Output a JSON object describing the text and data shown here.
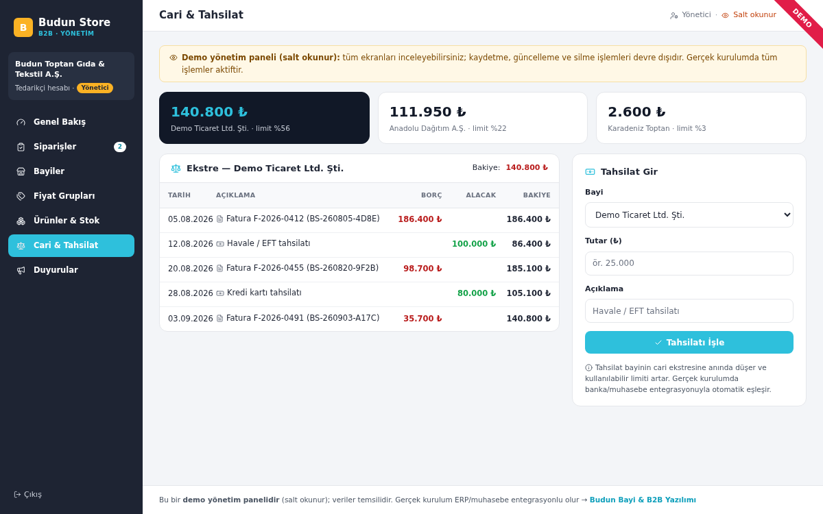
{
  "brand": {
    "logo_letter": "B",
    "name": "Budun Store",
    "subtitle": "B2B · YÖNETİM"
  },
  "account": {
    "company": "Budun Toptan Gıda & Tekstil A.Ş.",
    "type": "Tedarikçi hesabı ·",
    "role": "Yönetici"
  },
  "sidebar": {
    "items": [
      {
        "label": "Genel Bakış",
        "selected": false
      },
      {
        "label": "Siparişler",
        "selected": false,
        "badge": "2"
      },
      {
        "label": "Bayiler",
        "selected": false
      },
      {
        "label": "Fiyat Grupları",
        "selected": false
      },
      {
        "label": "Ürünler & Stok",
        "selected": false
      },
      {
        "label": "Cari & Tahsilat",
        "selected": true
      },
      {
        "label": "Duyurular",
        "selected": false
      }
    ],
    "logout": "Çıkış"
  },
  "header": {
    "title": "Cari & Tahsilat",
    "user": "Yönetici",
    "separator": "·",
    "mode": "Salt okunur",
    "ribbon": "DEMO"
  },
  "alert": "**Demo yönetim paneli (salt okunur):** tüm ekranları inceleyebilirsiniz; kaydetme, güncelleme ve silme işlemleri devre dışıdır. Gerçek kurulumda tüm işlemler aktiftir.",
  "balance_cards": [
    {
      "amount": "140.800 ₺",
      "caption": "Demo Ticaret Ltd. Şti. · limit %56",
      "selected": true
    },
    {
      "amount": "111.950 ₺",
      "caption": "Anadolu Dağıtım A.Ş. · limit %22",
      "selected": false
    },
    {
      "amount": "2.600 ₺",
      "caption": "Karadeniz Toptan · limit %3",
      "selected": false
    }
  ],
  "statement": {
    "title": "Ekstre — Demo Ticaret Ltd. Şti.",
    "balance_label": "Bakiye:",
    "balance": "140.800 ₺",
    "columns": [
      "TARİH",
      "AÇIKLAMA",
      "BORÇ",
      "ALACAK",
      "BAKİYE"
    ],
    "rows": [
      {
        "date": "05.08.2026",
        "kind": "invoice",
        "description": "Fatura F-2026-0412 (BS-260805-4D8E)",
        "debit": "186.400 ₺",
        "balance": "186.400 ₺"
      },
      {
        "date": "12.08.2026",
        "kind": "payment",
        "description": "Havale / EFT tahsilatı",
        "credit": "100.000 ₺",
        "balance": "86.400 ₺"
      },
      {
        "date": "20.08.2026",
        "kind": "invoice",
        "description": "Fatura F-2026-0455 (BS-260820-9F2B)",
        "debit": "98.700 ₺",
        "balance": "185.100 ₺"
      },
      {
        "date": "28.08.2026",
        "kind": "payment",
        "description": "Kredi kartı tahsilatı",
        "credit": "80.000 ₺",
        "balance": "105.100 ₺"
      },
      {
        "date": "03.09.2026",
        "kind": "invoice",
        "description": "Fatura F-2026-0491 (BS-260903-A17C)",
        "debit": "35.700 ₺",
        "balance": "140.800 ₺"
      }
    ]
  },
  "payment_form": {
    "title": "Tahsilat Gir",
    "dealer_label": "Bayi",
    "dealer_value": "Demo Ticaret Ltd. Şti.",
    "amount_label": "Tutar (₺)",
    "amount_placeholder": "ör. 25.000",
    "note_label": "Açıklama",
    "note_placeholder": "Havale / EFT tahsilatı",
    "submit": "Tahsilatı İşle",
    "info": "Tahsilat bayinin cari ekstresine anında düşer ve kullanılabilir limiti artar. Gerçek kurulumda banka/muhasebe entegrasyonuyla otomatik eşleşir."
  },
  "footer": {
    "text": "Bu bir **demo yönetim panelidir** (salt okunur); veriler temsilidir. Gerçek kurulum ERP/muhasebe entegrasyonlu olur →",
    "link": "Budun Bayi & B2B Yazılımı"
  }
}
